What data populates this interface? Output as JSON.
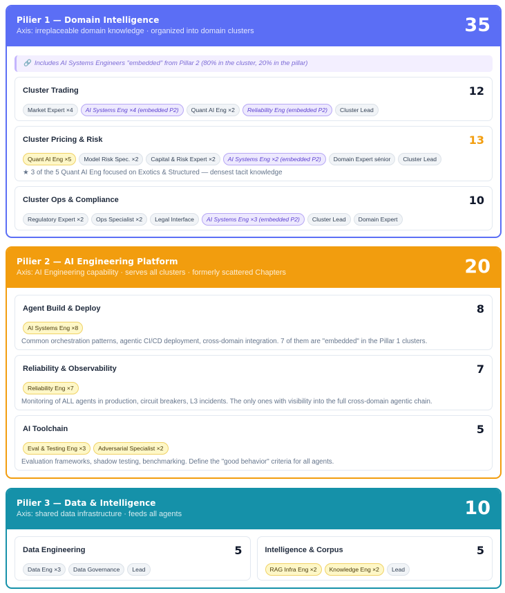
{
  "pillars": [
    {
      "title": "Pilier 1 — Domain Intelligence",
      "axis": "Axis: irreplaceable domain knowledge · organized into domain clusters",
      "count": "35",
      "note": "Includes AI Systems Engineers \"embedded\" from Pillar 2 (80% in the cluster, 20% in the pillar)",
      "clusters": [
        {
          "title": "Cluster Trading",
          "count": "12",
          "tags": [
            {
              "label": "Market Expert ×4",
              "style": "gray"
            },
            {
              "label": "AI Systems Eng ×4 (embedded P2)",
              "style": "purple"
            },
            {
              "label": "Quant AI Eng ×2",
              "style": "gray"
            },
            {
              "label": "Reliability Eng (embedded P2)",
              "style": "purple"
            },
            {
              "label": "Cluster Lead",
              "style": "gray"
            }
          ]
        },
        {
          "title": "Cluster Pricing & Risk",
          "count": "13",
          "count_color": "#f29d0e",
          "tags": [
            {
              "label": "Quant AI Eng ×5",
              "style": "yellow"
            },
            {
              "label": "Model Risk Spec. ×2",
              "style": "gray"
            },
            {
              "label": "Capital & Risk Expert ×2",
              "style": "gray"
            },
            {
              "label": "AI Systems Eng ×2 (embedded P2)",
              "style": "purple"
            },
            {
              "label": "Domain Expert sénior",
              "style": "gray"
            },
            {
              "label": "Cluster Lead",
              "style": "gray"
            }
          ],
          "footnote": "3 of the 5 Quant AI Eng focused on Exotics & Structured — densest tacit knowledge"
        },
        {
          "title": "Cluster Ops & Compliance",
          "count": "10",
          "tags": [
            {
              "label": "Regulatory Expert ×2",
              "style": "gray"
            },
            {
              "label": "Ops Specialist ×2",
              "style": "gray"
            },
            {
              "label": "Legal Interface",
              "style": "gray"
            },
            {
              "label": "AI Systems Eng ×3 (embedded P2)",
              "style": "purple"
            },
            {
              "label": "Cluster Lead",
              "style": "gray"
            },
            {
              "label": "Domain Expert",
              "style": "gray"
            }
          ]
        }
      ]
    },
    {
      "title": "Pilier 2 — AI Engineering Platform",
      "axis": "Axis: AI Engineering capability · serves all clusters · formerly scattered Chapters",
      "count": "20",
      "clusters": [
        {
          "title": "Agent Build & Deploy",
          "count": "8",
          "tags": [
            {
              "label": "AI Systems Eng ×8",
              "style": "yellow"
            }
          ],
          "description": "Common orchestration patterns, agentic CI/CD deployment, cross-domain integration. 7 of them are \"embedded\" in the Pillar 1 clusters."
        },
        {
          "title": "Reliability & Observability",
          "count": "7",
          "tags": [
            {
              "label": "Reliability Eng ×7",
              "style": "yellow"
            }
          ],
          "description": "Monitoring of ALL agents in production, circuit breakers, L3 incidents. The only ones with visibility into the full cross-domain agentic chain."
        },
        {
          "title": "AI Toolchain",
          "count": "5",
          "tags": [
            {
              "label": "Eval & Testing Eng ×3",
              "style": "yellow"
            },
            {
              "label": "Adversarial Specialist ×2",
              "style": "yellow"
            }
          ],
          "description": "Evaluation frameworks, shadow testing, benchmarking. Define the \"good behavior\" criteria for all agents."
        }
      ]
    },
    {
      "title": "Pilier 3 — Data & Intelligence",
      "axis": "Axis: shared data infrastructure · feeds all agents",
      "count": "10",
      "clusters": [
        {
          "title": "Data Engineering",
          "count": "5",
          "tags": [
            {
              "label": "Data Eng ×3",
              "style": "gray"
            },
            {
              "label": "Data Governance",
              "style": "gray"
            },
            {
              "label": "Lead",
              "style": "gray"
            }
          ]
        },
        {
          "title": "Intelligence & Corpus",
          "count": "5",
          "tags": [
            {
              "label": "RAG Infra Eng ×2",
              "style": "yellow"
            },
            {
              "label": "Knowledge Eng ×2",
              "style": "yellow"
            },
            {
              "label": "Lead",
              "style": "gray"
            }
          ]
        }
      ]
    }
  ],
  "icons": {
    "note": "paperclip-icon",
    "footnote": "star-icon"
  },
  "colors": {
    "pillar1": "#5b6ef5",
    "pillar2": "#f29d0e",
    "pillar3": "#1591a9",
    "embedded": "#ede9fe",
    "highlight": "#fef7c7"
  }
}
